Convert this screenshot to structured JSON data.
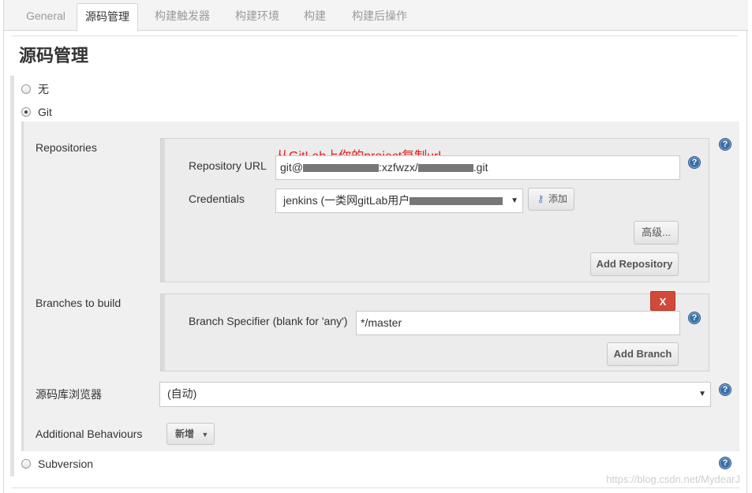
{
  "tabs": [
    {
      "label": "General"
    },
    {
      "label": "源码管理"
    },
    {
      "label": "构建触发器"
    },
    {
      "label": "构建环境"
    },
    {
      "label": "构建"
    },
    {
      "label": "构建后操作"
    }
  ],
  "section_title": "源码管理",
  "scm": {
    "options": {
      "none": "无",
      "git": "Git",
      "subversion": "Subversion"
    },
    "selected": "Git"
  },
  "repositories": {
    "label": "Repositories",
    "annotation": "从GitLab上你的project复制url",
    "url_label": "Repository URL",
    "url_prefix": "git@",
    "url_mid": ":xzfwzx/",
    "url_suffix": ".git",
    "credentials_label": "Credentials",
    "credentials_value": "jenkins (一类网gitLab用户",
    "add_credentials": "添加",
    "advanced_button": "高级...",
    "add_repository_button": "Add Repository"
  },
  "branches": {
    "label": "Branches to build",
    "delete_button": "X",
    "specifier_label": "Branch Specifier (blank for 'any')",
    "specifier_value": "*/master",
    "add_branch_button": "Add Branch"
  },
  "browser": {
    "label": "源码库浏览器",
    "value": "(自动)"
  },
  "behaviours": {
    "label": "Additional Behaviours",
    "add_button": "新增"
  },
  "help_glyph": "?",
  "watermark": "https://blog.csdn.net/MydearJ",
  "colors": {
    "accent_red": "#e31b1b",
    "delete_red": "#d24939",
    "help_blue": "#3a6fa8"
  }
}
